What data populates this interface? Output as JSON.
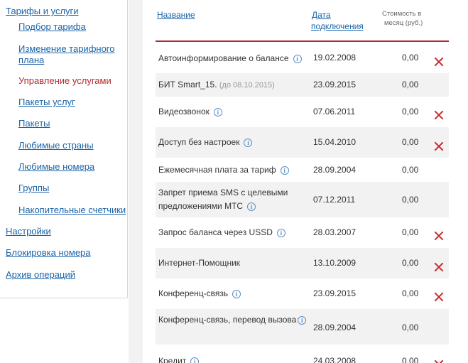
{
  "sidebar": {
    "items": [
      {
        "label": "Тарифы и услуги",
        "level": 0
      },
      {
        "label": "Подбор тарифа",
        "level": 1
      },
      {
        "label": "Изменение тарифного плана",
        "level": 1
      },
      {
        "label": "Управление услугами",
        "level": 1,
        "active": true
      },
      {
        "label": "Пакеты услуг",
        "level": 1
      },
      {
        "label": "Пакеты",
        "level": 1
      },
      {
        "label": "Любимые страны",
        "level": 1
      },
      {
        "label": "Любимые номера",
        "level": 1
      },
      {
        "label": "Группы",
        "level": 1
      },
      {
        "label": "Накопительные счетчики",
        "level": 1
      },
      {
        "label": "Настройки",
        "level": 0
      },
      {
        "label": "Блокировка номера",
        "level": 0
      },
      {
        "label": "Архив операций",
        "level": 0
      }
    ]
  },
  "table": {
    "headers": {
      "name": "Название",
      "date_line1": "Дата",
      "date_line2": "подключения",
      "cost_line1": "Стоимость в",
      "cost_line2": "месяц (руб.)"
    },
    "rows": [
      {
        "name": "Автоинформирование о балансе",
        "info": true,
        "date": "19.02.2008",
        "cost": "0,00",
        "deletable": true
      },
      {
        "name": "БИТ Smart_15.",
        "note": "(до 08.10.2015)",
        "info": false,
        "date": "23.09.2015",
        "cost": "0,00",
        "deletable": false
      },
      {
        "name": "Видеозвонок",
        "info": true,
        "date": "07.06.2011",
        "cost": "0,00",
        "deletable": true
      },
      {
        "name": "Доступ без настроек",
        "info": true,
        "date": "15.04.2010",
        "cost": "0,00",
        "deletable": true
      },
      {
        "name": "Ежемесячная плата за тариф",
        "info": true,
        "date": "28.09.2004",
        "cost": "0,00",
        "deletable": false
      },
      {
        "name": "Запрет приема SMS с целевыми предложениями МТС",
        "info": true,
        "date": "07.12.2011",
        "cost": "0,00",
        "deletable": false
      },
      {
        "name": "Запрос баланса через USSD",
        "info": true,
        "date": "28.03.2007",
        "cost": "0,00",
        "deletable": true
      },
      {
        "name": "Интернет-Помощник",
        "info": false,
        "date": "13.10.2009",
        "cost": "0,00",
        "deletable": true
      },
      {
        "name": "Конференц-связь",
        "info": true,
        "date": "23.09.2015",
        "cost": "0,00",
        "deletable": true
      },
      {
        "name": "Конференц-связь, перевод вызова",
        "info": true,
        "date": "28.09.2004",
        "cost": "0,00",
        "deletable": false
      },
      {
        "name": "Кредит",
        "info": true,
        "date": "24.03.2008",
        "cost": "0,00",
        "deletable": true
      }
    ]
  },
  "colors": {
    "link": "#1a63a8",
    "active": "#b3282d",
    "delete": "#c8282d",
    "alt_row": "#f2f2f2"
  },
  "icons": {
    "info": "info-circle-icon",
    "delete": "delete-cross-icon"
  }
}
